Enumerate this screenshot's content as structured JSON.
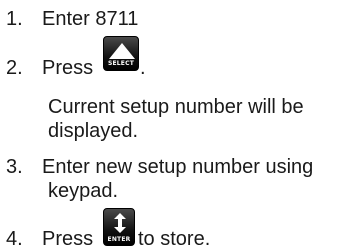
{
  "steps": [
    {
      "number": "1.",
      "text": "Enter 8711"
    },
    {
      "number": "2.",
      "text": "Press",
      "suffix": ".",
      "key": {
        "label": "SELECT",
        "icon": "up-triangle"
      }
    },
    {
      "note_line1": "Current setup number will be",
      "note_line2": "displayed."
    },
    {
      "number": "3.",
      "text_line1": "Enter new setup number using",
      "text_line2": "keypad."
    },
    {
      "number": "4.",
      "text": "Press",
      "suffix": "to store.",
      "key": {
        "label": "ENTER",
        "icon": "enter-arrow"
      }
    }
  ]
}
